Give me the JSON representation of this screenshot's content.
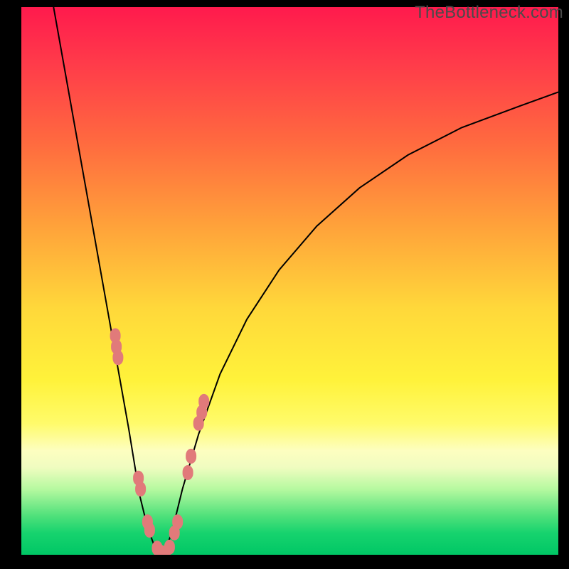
{
  "watermark": "TheBottleneck.com",
  "colors": {
    "background": "#000000",
    "gradient_top": "#ff1a4d",
    "gradient_mid": "#ffd83a",
    "gradient_bottom": "#00c765",
    "curve": "#000000",
    "marker": "#e17a7a"
  },
  "chart_data": {
    "type": "line",
    "title": "",
    "xlabel": "",
    "ylabel": "",
    "x_range": [
      0,
      100
    ],
    "y_range": [
      0,
      100
    ],
    "series": [
      {
        "name": "left-curve",
        "x": [
          6,
          8,
          10,
          12,
          14,
          16,
          18,
          20,
          22,
          23.5,
          25,
          26.5
        ],
        "y": [
          100,
          89,
          78,
          67,
          56,
          45,
          34,
          23,
          11,
          5,
          1,
          0
        ]
      },
      {
        "name": "right-curve",
        "x": [
          26.5,
          28,
          30,
          33,
          37,
          42,
          48,
          55,
          63,
          72,
          82,
          93,
          100
        ],
        "y": [
          0,
          4,
          12,
          22,
          33,
          43,
          52,
          60,
          67,
          73,
          78,
          82,
          84.5
        ]
      }
    ],
    "markers": [
      {
        "x": 17.5,
        "y": 40
      },
      {
        "x": 17.7,
        "y": 38
      },
      {
        "x": 18.0,
        "y": 36
      },
      {
        "x": 21.8,
        "y": 14
      },
      {
        "x": 22.2,
        "y": 12
      },
      {
        "x": 23.5,
        "y": 6
      },
      {
        "x": 23.9,
        "y": 4.5
      },
      {
        "x": 25.3,
        "y": 1.2
      },
      {
        "x": 26.1,
        "y": 0.4
      },
      {
        "x": 26.8,
        "y": 0.3
      },
      {
        "x": 27.6,
        "y": 1.4
      },
      {
        "x": 28.5,
        "y": 4
      },
      {
        "x": 29.1,
        "y": 6
      },
      {
        "x": 31.0,
        "y": 15
      },
      {
        "x": 31.6,
        "y": 18
      },
      {
        "x": 33.0,
        "y": 24
      },
      {
        "x": 33.6,
        "y": 26
      },
      {
        "x": 34.0,
        "y": 28
      }
    ],
    "annotations": []
  }
}
